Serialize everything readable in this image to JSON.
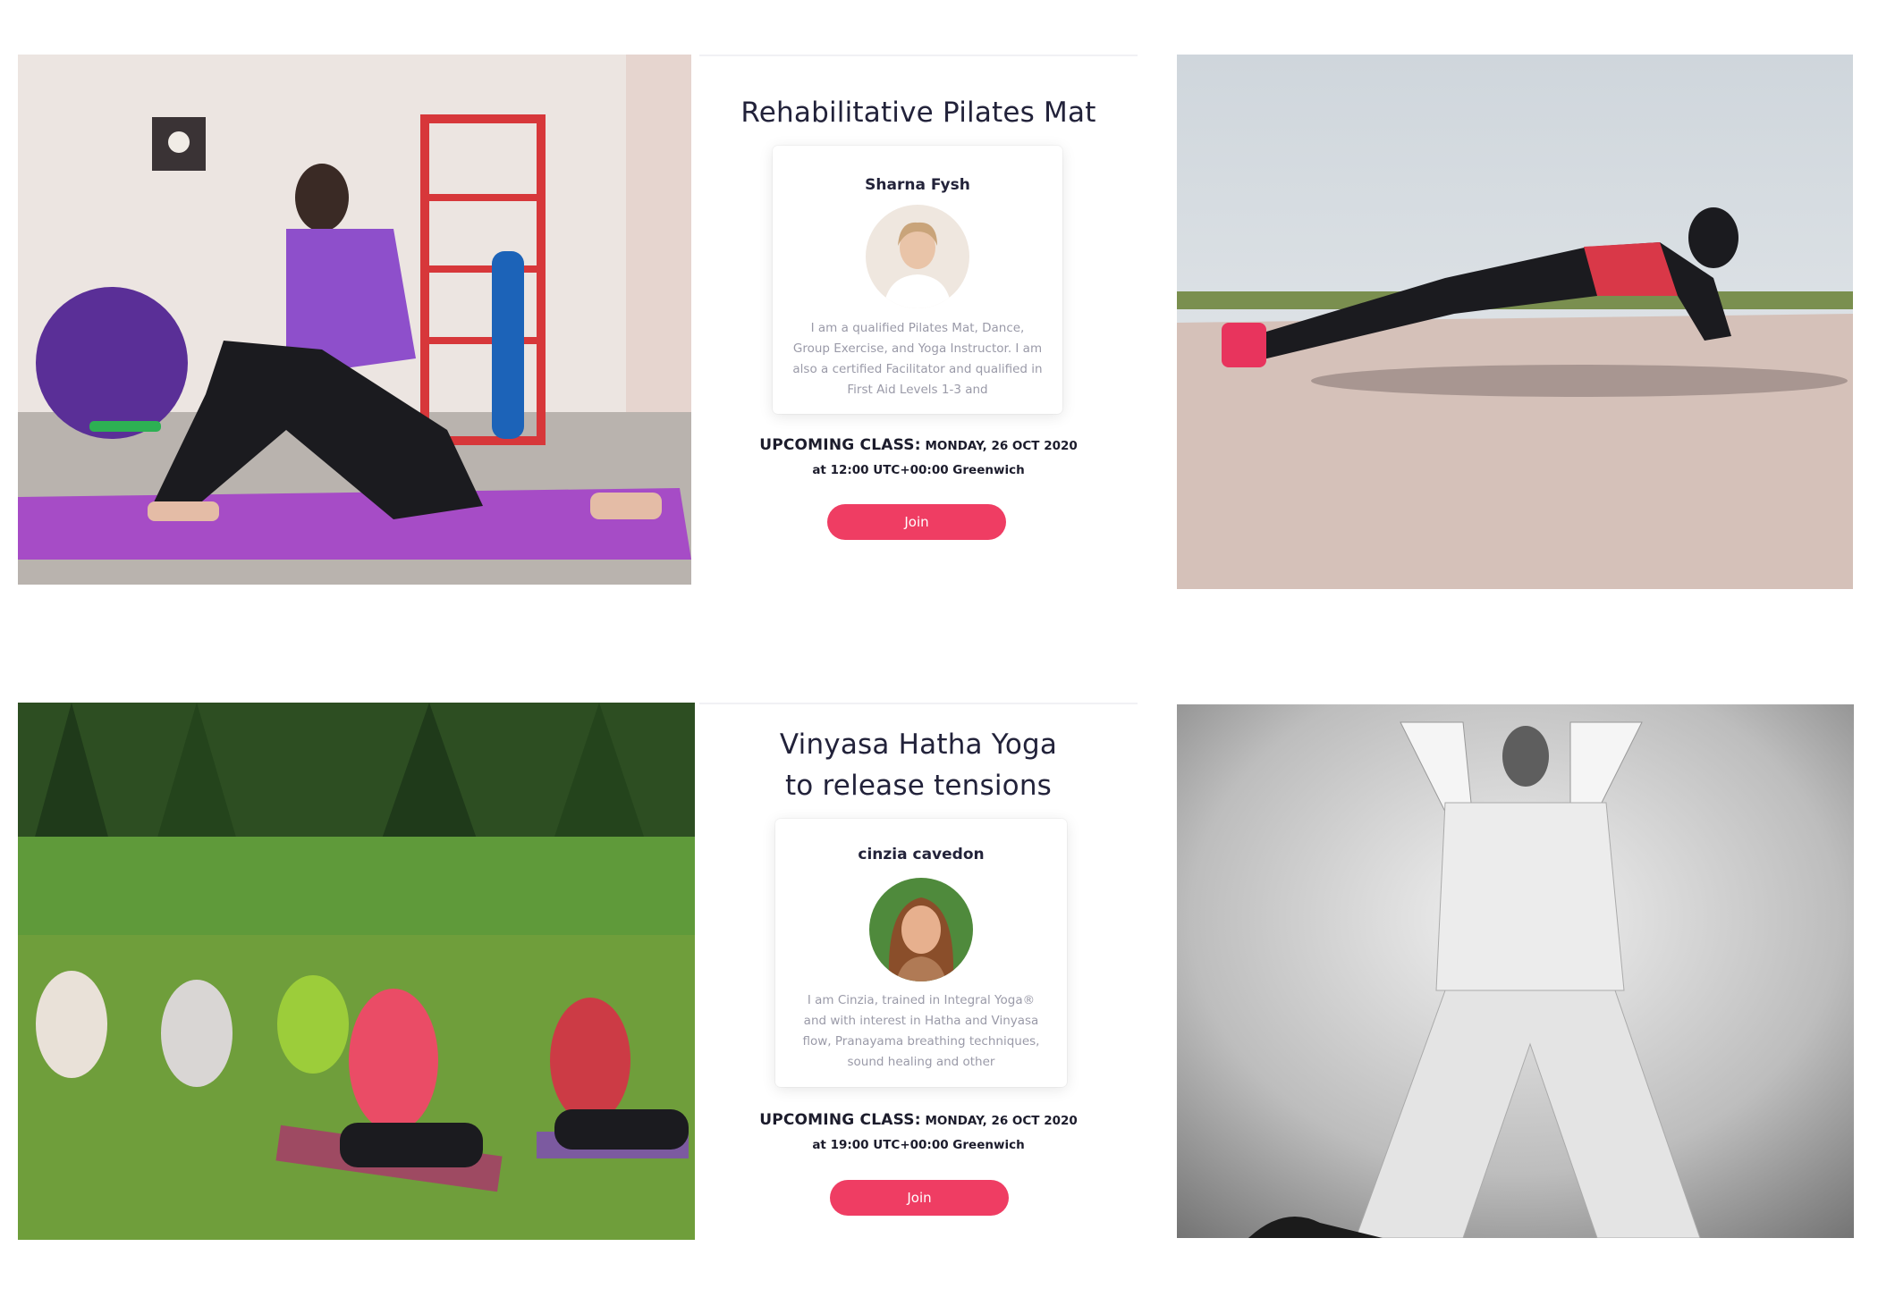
{
  "classes": [
    {
      "title": "Rehabilitative Pilates Mat",
      "instructor": "Sharna Fysh",
      "bio": "I am a qualified Pilates Mat, Dance, Group Exercise, and Yoga Instructor. I am also a certified Facilitator and qualified in First Aid Levels 1-3 and",
      "upcoming_label": "UPCOMING CLASS:",
      "upcoming_date": "MONDAY, 26 OCT 2020",
      "upcoming_time": "at 12:00 UTC+00:00 Greenwich",
      "join_label": "Join"
    },
    {
      "title": "Vinyasa Hatha Yoga to release tensions",
      "instructor": "cinzia cavedon",
      "bio": "I am Cinzia, trained in Integral Yoga® and with interest in Hatha and Vinyasa flow, Pranayama breathing techniques, sound healing and other",
      "upcoming_label": "UPCOMING CLASS:",
      "upcoming_date": "MONDAY, 26 OCT 2020",
      "upcoming_time": "at 19:00 UTC+00:00 Greenwich",
      "join_label": "Join"
    }
  ],
  "colors": {
    "accent": "#ef3d63"
  }
}
